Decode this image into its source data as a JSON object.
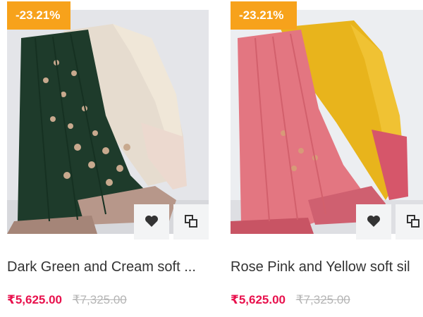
{
  "products": [
    {
      "discount": "-23.21%",
      "title": "Dark Green and Cream soft silk saree",
      "title_display": "Dark Green and Cream soft ...",
      "price": "₹5,625.00",
      "original_price": "₹7,325.00",
      "colors": {
        "body": "#1f3d2c",
        "accent": "#e6d8cc",
        "border": "#b89b8c"
      },
      "icons": {
        "wishlist": "heart-icon",
        "compare": "compare-icon"
      }
    },
    {
      "discount": "-23.21%",
      "title": "Rose Pink and Yellow soft silk saree",
      "title_display": "Rose Pink and Yellow soft sil",
      "price": "₹5,625.00",
      "original_price": "₹7,325.00",
      "colors": {
        "body": "#e0727c",
        "accent": "#e8b51d",
        "border": "#d45c6a"
      },
      "icons": {
        "wishlist": "heart-icon",
        "compare": "compare-icon"
      }
    }
  ],
  "theme": {
    "badge": "#f7a21b",
    "sale_price": "#e8114d",
    "original_price": "#b5b5b5",
    "title": "#333333",
    "button_bg": "#f3f4f5"
  }
}
